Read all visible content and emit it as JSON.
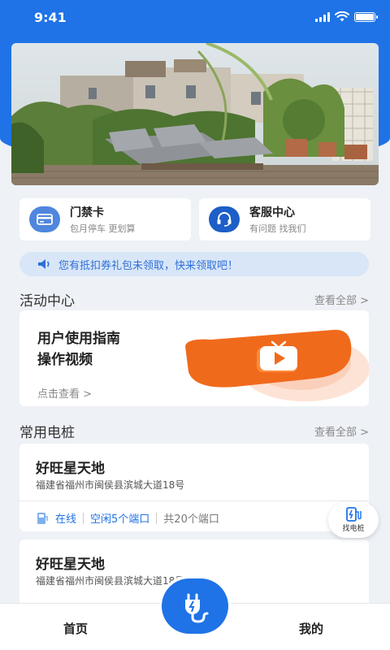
{
  "status_bar": {
    "time": "9:41"
  },
  "quick_actions": [
    {
      "title": "门禁卡",
      "subtitle": "包月停车 更划算",
      "icon": "card-icon"
    },
    {
      "title": "客服中心",
      "subtitle": "有问题 找我们",
      "icon": "headset-icon"
    }
  ],
  "notice": {
    "text": "您有抵扣券礼包未领取，快来领取吧！",
    "icon": "speaker-icon"
  },
  "activity": {
    "section_title": "活动中心",
    "see_all": "查看全部 >",
    "card_title": "用户使用指南\n操作视频",
    "card_link": "点击查看 >"
  },
  "stations": {
    "section_title": "常用电桩",
    "see_all": "查看全部 >",
    "items": [
      {
        "name": "好旺星天地",
        "address": "福建省福州市闽侯县滨城大道18号",
        "status": "在线",
        "idle": "空闲5个端口",
        "total": "共20个端口"
      },
      {
        "name": "好旺星天地",
        "address": "福建省福州市闽侯县滨城大道18号"
      }
    ]
  },
  "float_button": {
    "label": "找电桩",
    "icon": "charging-station-icon"
  },
  "tabbar": {
    "home": "首页",
    "mine": "我的",
    "center_icon": "charging-plug-icon"
  },
  "colors": {
    "primary": "#1f73e6",
    "accent_orange": "#f06a1c"
  }
}
